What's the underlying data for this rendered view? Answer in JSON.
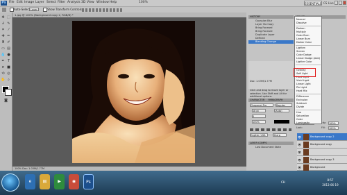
{
  "menubar": {
    "logo": "Ps",
    "items": [
      "File",
      "Edit",
      "Image",
      "Layer",
      "Select",
      "Filter",
      "Analysis",
      "3D",
      "View",
      "Window",
      "Help"
    ],
    "zoom": "100%",
    "workspace": "ESSENTIALS",
    "cs_live": "CS Live"
  },
  "optbar": {
    "auto_select": "Auto-Select:",
    "auto_select_value": "Layer",
    "show_transform": "Show Transform Controls"
  },
  "document": {
    "tab_title": "1.jpg @ 100% (Background copy 2, RGB/8) *",
    "status": "100%    Doc: 1.03M/1.77M"
  },
  "history": {
    "header": "HISTORY",
    "items": [
      "Gaussian Blur",
      "Layer Via Copy",
      "Bring Forward",
      "Bring Forward",
      "Duplicate Layer",
      "Defined",
      "Blending Change"
    ],
    "selected_index": 6
  },
  "blend_menu": {
    "groups": [
      [
        "Normal",
        "Dissolve"
      ],
      [
        "Darken",
        "Multiply",
        "Color Burn",
        "Linear Burn",
        "Darker Color"
      ],
      [
        "Lighten",
        "Screen",
        "Color Dodge",
        "Linear Dodge (Add)",
        "Lighter Color"
      ],
      [
        "Overlay",
        "Soft Light",
        "Hard Light",
        "Vivid Light",
        "Linear Light",
        "Pin Light",
        "Hard Mix"
      ],
      [
        "Difference",
        "Exclusion",
        "Subtract",
        "Divide"
      ],
      [
        "Hue",
        "Saturation",
        "Color",
        "Luminosity"
      ]
    ],
    "highlighted": "Screen"
  },
  "color_panel": {
    "header": "COLOR",
    "tab2": "SWATCHES"
  },
  "info_panel": {
    "doc": "Doc: 1.03M/1.77M",
    "hint": "Click and drag to move layer or selection. Use Shift and Alt for additional options."
  },
  "character": {
    "header": "CHARACTER",
    "tab2": "PARAGRAPH",
    "font": "Chaparral Pro",
    "style": "Regular",
    "size": "18 pt",
    "leading": "(Auto)",
    "tracking": "0",
    "scale": "100%",
    "lang": "English: USA",
    "aa": "Sharp"
  },
  "layers": {
    "blend": "Overlay",
    "opacity_label": "Opacity:",
    "opacity": "100%",
    "fill_label": "Fill:",
    "fill": "100%",
    "lock_label": "Lock:",
    "rows": [
      {
        "name": "Background copy 2",
        "selected": true
      },
      {
        "name": "Background copy",
        "selected": false
      },
      {
        "name": "",
        "selected": false
      },
      {
        "name": "Background copy 3",
        "selected": false
      },
      {
        "name": "Background",
        "selected": false
      }
    ]
  },
  "layer_comps": {
    "header": "LAYER COMPS",
    "item": "Last Document State"
  },
  "taskbar": {
    "icons": [
      "ie-icon",
      "explorer-icon",
      "player-icon",
      "chrome-icon",
      "ps-icon"
    ],
    "lang": "CH",
    "time": "8:57",
    "date": "2013-06-19"
  },
  "colors": {
    "accent": "#3a78c9",
    "highlight": "#e01515",
    "taskbar": "#2a4f6e"
  }
}
